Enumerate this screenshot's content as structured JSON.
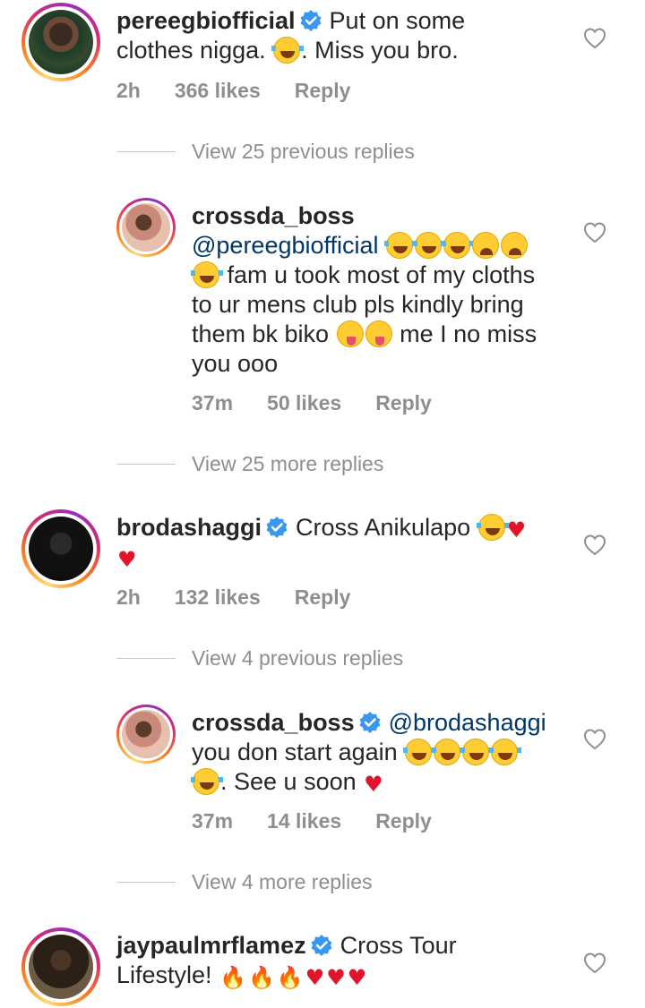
{
  "comments": [
    {
      "username": "pereegbiofficial",
      "text1": "Put on some",
      "text2": "clothes nigga.",
      "text3": ". Miss you bro.",
      "time": "2h",
      "likes": "366 likes",
      "reply": "Reply"
    },
    {
      "username": "crossda_boss",
      "mention": "@pereegbiofficial",
      "text1": "fam u took most of my cloths",
      "text2": "to ur mens club pls kindly bring",
      "text3": "them bk biko",
      "text4": "me I no miss",
      "text5": "you ooo",
      "time": "37m",
      "likes": "50 likes",
      "reply": "Reply"
    },
    {
      "username": "brodashaggi",
      "text1": "Cross Anikulapo",
      "time": "2h",
      "likes": "132 likes",
      "reply": "Reply"
    },
    {
      "username": "crossda_boss",
      "mention": "@brodashaggi",
      "text1": "you don start again",
      "text2": ". See u soon",
      "time": "37m",
      "likes": "14 likes",
      "reply": "Reply"
    },
    {
      "username": "jaypaulmrflamez",
      "text1": "Cross Tour",
      "text2": "Lifestyle!"
    }
  ],
  "view_links": [
    "View 25 previous replies",
    "View 25 more replies",
    "View 4 previous replies",
    "View 4 more replies"
  ],
  "colors": {
    "text": "#262626",
    "muted": "#8e8e8e",
    "mention": "#00376b",
    "verified": "#3897f0",
    "heart": "#e0142a"
  }
}
